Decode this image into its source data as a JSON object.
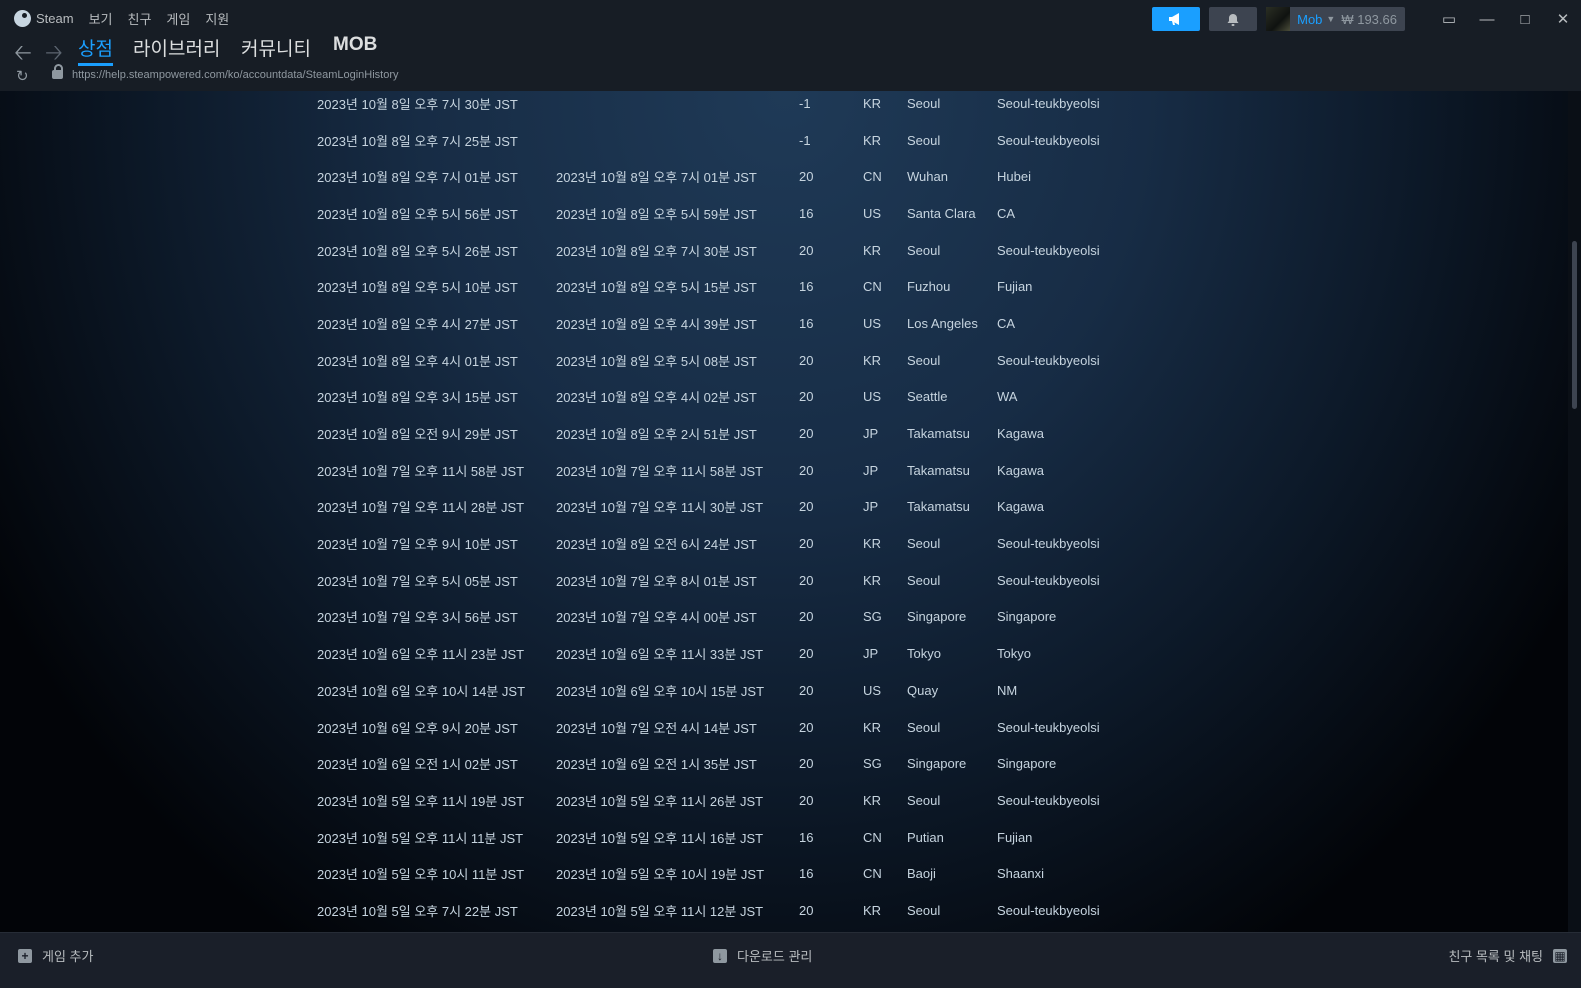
{
  "menu": {
    "app": "Steam",
    "items": [
      "보기",
      "친구",
      "게임",
      "지원"
    ]
  },
  "account": {
    "name": "Mob",
    "balance": "₩ 193.66"
  },
  "nav": {
    "tabs": [
      "상점",
      "라이브러리",
      "커뮤니티",
      "MOB"
    ]
  },
  "url": "https://help.steampowered.com/ko/accountdata/SteamLoginHistory",
  "login_history": [
    [
      "2023년 10월 8일 오후 7시 30분 JST",
      "",
      "-1",
      "KR",
      "Seoul",
      "Seoul-teukbyeolsi"
    ],
    [
      "2023년 10월 8일 오후 7시 25분 JST",
      "",
      "-1",
      "KR",
      "Seoul",
      "Seoul-teukbyeolsi"
    ],
    [
      "2023년 10월 8일 오후 7시 01분 JST",
      "2023년 10월 8일 오후 7시 01분 JST",
      "20",
      "CN",
      "Wuhan",
      "Hubei"
    ],
    [
      "2023년 10월 8일 오후 5시 56분 JST",
      "2023년 10월 8일 오후 5시 59분 JST",
      "16",
      "US",
      "Santa Clara",
      "CA"
    ],
    [
      "2023년 10월 8일 오후 5시 26분 JST",
      "2023년 10월 8일 오후 7시 30분 JST",
      "20",
      "KR",
      "Seoul",
      "Seoul-teukbyeolsi"
    ],
    [
      "2023년 10월 8일 오후 5시 10분 JST",
      "2023년 10월 8일 오후 5시 15분 JST",
      "16",
      "CN",
      "Fuzhou",
      "Fujian"
    ],
    [
      "2023년 10월 8일 오후 4시 27분 JST",
      "2023년 10월 8일 오후 4시 39분 JST",
      "16",
      "US",
      "Los Angeles",
      "CA"
    ],
    [
      "2023년 10월 8일 오후 4시 01분 JST",
      "2023년 10월 8일 오후 5시 08분 JST",
      "20",
      "KR",
      "Seoul",
      "Seoul-teukbyeolsi"
    ],
    [
      "2023년 10월 8일 오후 3시 15분 JST",
      "2023년 10월 8일 오후 4시 02분 JST",
      "20",
      "US",
      "Seattle",
      "WA"
    ],
    [
      "2023년 10월 8일 오전 9시 29분 JST",
      "2023년 10월 8일 오후 2시 51분 JST",
      "20",
      "JP",
      "Takamatsu",
      "Kagawa"
    ],
    [
      "2023년 10월 7일 오후 11시 58분 JST",
      "2023년 10월 7일 오후 11시 58분 JST",
      "20",
      "JP",
      "Takamatsu",
      "Kagawa"
    ],
    [
      "2023년 10월 7일 오후 11시 28분 JST",
      "2023년 10월 7일 오후 11시 30분 JST",
      "20",
      "JP",
      "Takamatsu",
      "Kagawa"
    ],
    [
      "2023년 10월 7일 오후 9시 10분 JST",
      "2023년 10월 8일 오전 6시 24분 JST",
      "20",
      "KR",
      "Seoul",
      "Seoul-teukbyeolsi"
    ],
    [
      "2023년 10월 7일 오후 5시 05분 JST",
      "2023년 10월 7일 오후 8시 01분 JST",
      "20",
      "KR",
      "Seoul",
      "Seoul-teukbyeolsi"
    ],
    [
      "2023년 10월 7일 오후 3시 56분 JST",
      "2023년 10월 7일 오후 4시 00분 JST",
      "20",
      "SG",
      "Singapore",
      "Singapore"
    ],
    [
      "2023년 10월 6일 오후 11시 23분 JST",
      "2023년 10월 6일 오후 11시 33분 JST",
      "20",
      "JP",
      "Tokyo",
      "Tokyo"
    ],
    [
      "2023년 10월 6일 오후 10시 14분 JST",
      "2023년 10월 6일 오후 10시 15분 JST",
      "20",
      "US",
      "Quay",
      "NM"
    ],
    [
      "2023년 10월 6일 오후 9시 20분 JST",
      "2023년 10월 7일 오전 4시 14분 JST",
      "20",
      "KR",
      "Seoul",
      "Seoul-teukbyeolsi"
    ],
    [
      "2023년 10월 6일 오전 1시 02분 JST",
      "2023년 10월 6일 오전 1시 35분 JST",
      "20",
      "SG",
      "Singapore",
      "Singapore"
    ],
    [
      "2023년 10월 5일 오후 11시 19분 JST",
      "2023년 10월 5일 오후 11시 26분 JST",
      "20",
      "KR",
      "Seoul",
      "Seoul-teukbyeolsi"
    ],
    [
      "2023년 10월 5일 오후 11시 11분 JST",
      "2023년 10월 5일 오후 11시 16분 JST",
      "16",
      "CN",
      "Putian",
      "Fujian"
    ],
    [
      "2023년 10월 5일 오후 10시 11분 JST",
      "2023년 10월 5일 오후 10시 19분 JST",
      "16",
      "CN",
      "Baoji",
      "Shaanxi"
    ],
    [
      "2023년 10월 5일 오후 7시 22분 JST",
      "2023년 10월 5일 오후 11시 12분 JST",
      "20",
      "KR",
      "Seoul",
      "Seoul-teukbyeolsi"
    ]
  ],
  "bottom": {
    "add_game": "게임 추가",
    "downloads": "다운로드 관리",
    "friends": "친구 목록 및 채팅"
  }
}
